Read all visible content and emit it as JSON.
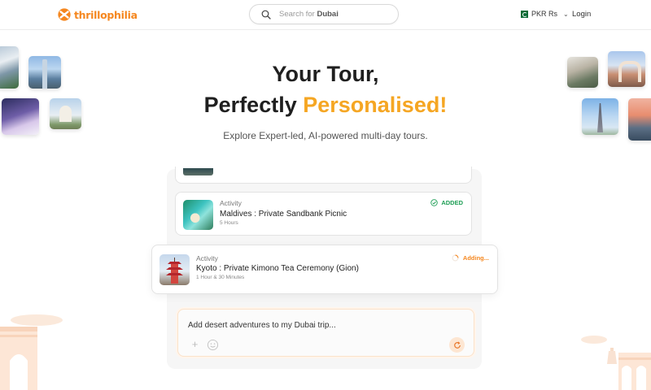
{
  "brand": {
    "name": "thrillophilia",
    "color": "#f5871f"
  },
  "header": {
    "search": {
      "prefix": "Search for",
      "term": "Dubai",
      "icon": "search-icon"
    },
    "currency": {
      "label": "PKR Rs",
      "flag": "pakistan-flag-icon"
    },
    "login_label": "Login"
  },
  "hero": {
    "line1": "Your Tour,",
    "line2_plain": "Perfectly",
    "line2_accent": "Personalised!",
    "accent_color": "#f5a623",
    "subtitle": "Explore Expert-led, AI-powered multi-day tours."
  },
  "activities": [
    {
      "type": "Activity",
      "title": "Maldives : Private Sandbank Picnic",
      "duration": "5 Hours",
      "status": "ADDED",
      "status_color": "#1e9e55"
    },
    {
      "type": "Activity",
      "title": "Kyoto : Private Kimono Tea Ceremony (Gion)",
      "duration": "1 Hour & 30 Minutes",
      "status": "Adding...",
      "status_color": "#f5871f"
    }
  ],
  "prompt": {
    "text": "Add desert adventures to my Dubai trip...",
    "plus_label": "+"
  }
}
